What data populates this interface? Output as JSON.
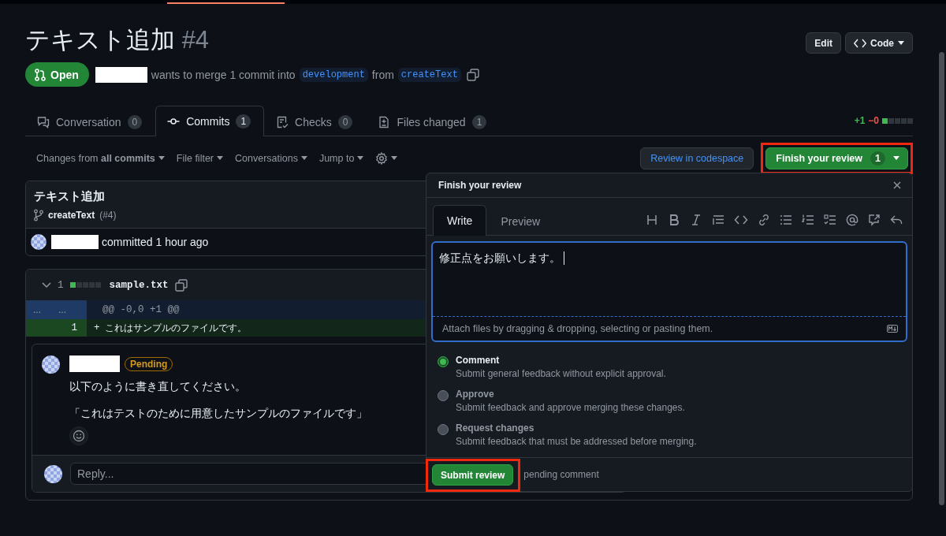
{
  "pull_request": {
    "title": "テキスト追加",
    "number": "#4",
    "state": "Open",
    "summary": "wants to merge 1 commit into",
    "base_branch": "development",
    "from_label": "from",
    "head_branch": "createText"
  },
  "header_buttons": [
    {
      "label": "Edit",
      "kind": "plain"
    },
    {
      "label": "Code",
      "kind": "code"
    }
  ],
  "tabs": [
    {
      "label": "Conversation",
      "count": "0",
      "kind": "conversation",
      "selected": false
    },
    {
      "label": "Commits",
      "count": "1",
      "kind": "commits",
      "selected": true
    },
    {
      "label": "Checks",
      "count": "0",
      "kind": "checks",
      "selected": false
    },
    {
      "label": "Files changed",
      "count": "1",
      "kind": "files",
      "selected": false
    }
  ],
  "diff_stat": {
    "additions": "+1",
    "deletions": "−0",
    "level": 0.2
  },
  "filters": [
    "Changes from **all commits**",
    "File filter",
    "Conversations",
    "Jump to"
  ],
  "review_in_codespace": "Review in codespace",
  "finish_review": {
    "label": "Finish your review",
    "count": "1"
  },
  "commit": {
    "title": "テキスト追加",
    "branch": "createText",
    "pr_ref": "(#4)",
    "committed": "committed 1 hour ago"
  },
  "file": {
    "changes": "1",
    "name": "sample.txt",
    "level": 0.2,
    "hunk_left": "...",
    "hunk_right": "...",
    "hunk": "@@ -0,0 +1 @@",
    "lines": [
      {
        "number": "1",
        "marker": "+",
        "text": "これはサンプルのファイルです。"
      }
    ]
  },
  "comment": {
    "badge": "Pending",
    "paragraphs": [
      "以下のように書き直してください。",
      "「これはテストのために用意したサンプルのファイルです」"
    ],
    "reply_placeholder": "Reply..."
  },
  "review_popover": {
    "title": "Finish your review",
    "tabs": [
      {
        "label": "Write",
        "selected": true
      },
      {
        "label": "Preview",
        "selected": false
      }
    ],
    "value": "修正点をお願いします。",
    "attach_hint": "Attach files by dragging & dropping, selecting or pasting them.",
    "options": [
      {
        "label": "Comment",
        "description": "Submit general feedback without explicit approval.",
        "selected": true
      },
      {
        "label": "Approve",
        "description": "Submit feedback and approve merging these changes.",
        "selected": false
      },
      {
        "label": "Request changes",
        "description": "Submit feedback that must be addressed before merging.",
        "selected": false
      }
    ],
    "submit": "Submit review",
    "pending": "pending comment"
  }
}
